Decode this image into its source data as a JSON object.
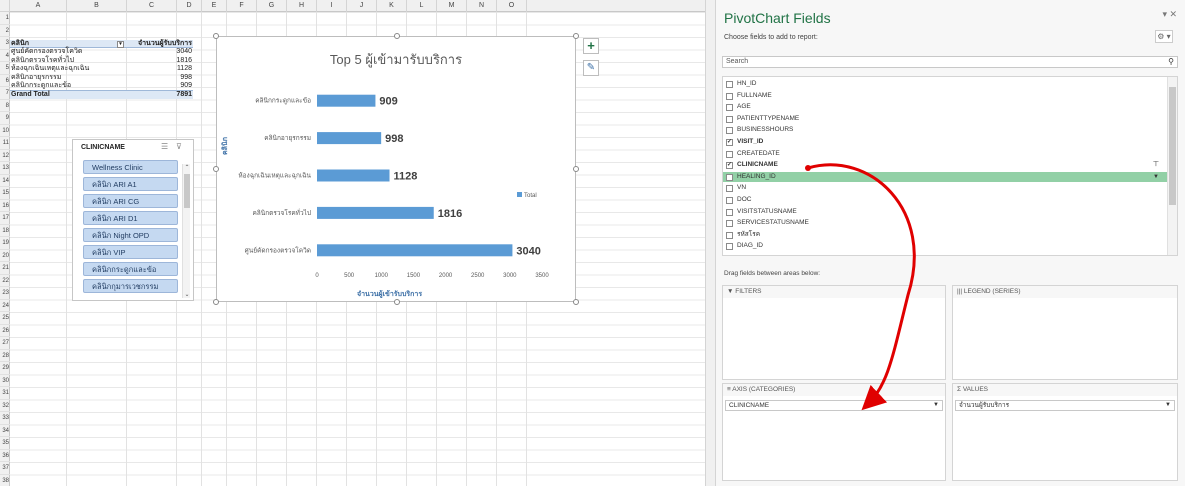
{
  "sheet": {
    "columns": [
      "A",
      "B",
      "C",
      "D",
      "E",
      "F",
      "G",
      "H",
      "I",
      "J",
      "K",
      "L",
      "M",
      "N",
      "O"
    ],
    "rows": [
      "1",
      "2",
      "3",
      "4",
      "5",
      "6",
      "7",
      "8",
      "9",
      "10",
      "11",
      "12",
      "13",
      "14",
      "15",
      "16",
      "17",
      "18",
      "19",
      "20",
      "21",
      "22",
      "23",
      "24",
      "25",
      "26",
      "27",
      "28",
      "29",
      "30",
      "31",
      "32",
      "33",
      "34",
      "35",
      "36",
      "37",
      "38"
    ]
  },
  "pivot": {
    "header_label": "คลินิก",
    "header_value": "จำนวนผู้รับบริการ",
    "rows": [
      {
        "label": "ศูนย์คัดกรองตรวจโควิด",
        "value": "3040"
      },
      {
        "label": "คลินิกตรวจโรคทั่วไป",
        "value": "1816"
      },
      {
        "label": "ห้องฉุกเฉินเหตุและฉุกเฉิน",
        "value": "1128"
      },
      {
        "label": "คลินิกอายุรกรรม",
        "value": "998"
      },
      {
        "label": "คลินิกกระดูกและข้อ",
        "value": "909"
      }
    ],
    "total_label": "Grand Total",
    "total_value": "7891"
  },
  "slicer": {
    "title": "CLINICNAME",
    "items": [
      "Wellness Clinic",
      "คลินิก ARI A1",
      "คลินิก ARI CG",
      "คลินิก ARI D1",
      "คลินิก Night OPD",
      "คลินิก VIP",
      "คลินิกกระดูกและข้อ",
      "คลินิกกุมารเวชกรรม"
    ]
  },
  "chart_data": {
    "type": "bar",
    "orientation": "horizontal",
    "title": "Top 5 ผู้เข้ามารับบริการ",
    "categories": [
      "คลินิกกระดูกและข้อ",
      "คลินิกอายุรกรรม",
      "ห้องฉุกเฉินเหตุและฉุกเฉิน",
      "คลินิกตรวจโรคทั่วไป",
      "ศูนย์คัดกรองตรวจโควิด"
    ],
    "values": [
      909,
      998,
      1128,
      1816,
      3040
    ],
    "series": [
      {
        "name": "Total",
        "values": [
          909,
          998,
          1128,
          1816,
          3040
        ]
      }
    ],
    "xlabel": "จำนวนผู้เข้ารับบริการ",
    "ylabel": "คลินิก",
    "xlim": [
      0,
      3500
    ],
    "xticks": [
      "0",
      "500",
      "1000",
      "1500",
      "2000",
      "2500",
      "3000",
      "3500"
    ],
    "legend_position": "right",
    "grid": false,
    "bar_color": "#5b9bd5"
  },
  "panel": {
    "title": "PivotChart Fields",
    "subtitle": "Choose fields to add to report:",
    "search_placeholder": "Search",
    "fields": [
      {
        "name": "HN_ID",
        "checked": false
      },
      {
        "name": "FULLNAME",
        "checked": false
      },
      {
        "name": "AGE",
        "checked": false
      },
      {
        "name": "PATIENTTYPENAME",
        "checked": false
      },
      {
        "name": "BUSINESSHOURS",
        "checked": false
      },
      {
        "name": "VISIT_ID",
        "checked": true
      },
      {
        "name": "CREATEDATE",
        "checked": false
      },
      {
        "name": "CLINICNAME",
        "checked": true
      },
      {
        "name": "HEALING_ID",
        "checked": false
      },
      {
        "name": "VN",
        "checked": false
      },
      {
        "name": "DOC",
        "checked": false
      },
      {
        "name": "VISITSTATUSNAME",
        "checked": false
      },
      {
        "name": "SERVICESTATUSNAME",
        "checked": false
      },
      {
        "name": "รหัสโรค",
        "checked": false
      },
      {
        "name": "DIAG_ID",
        "checked": false
      }
    ],
    "drag_label": "Drag fields between areas below:",
    "areas": {
      "filters": "FILTERS",
      "legend": "LEGEND (SERIES)",
      "axis": "AXIS (CATEGORIES)",
      "values": "VALUES",
      "axis_item": "CLINICNAME",
      "values_item": "จำนวนผู้รับบริการ"
    }
  },
  "colors": {
    "accent": "#217346",
    "bar": "#5b9bd5",
    "highlight": "#92d0a6",
    "arrow": "#e00000"
  }
}
